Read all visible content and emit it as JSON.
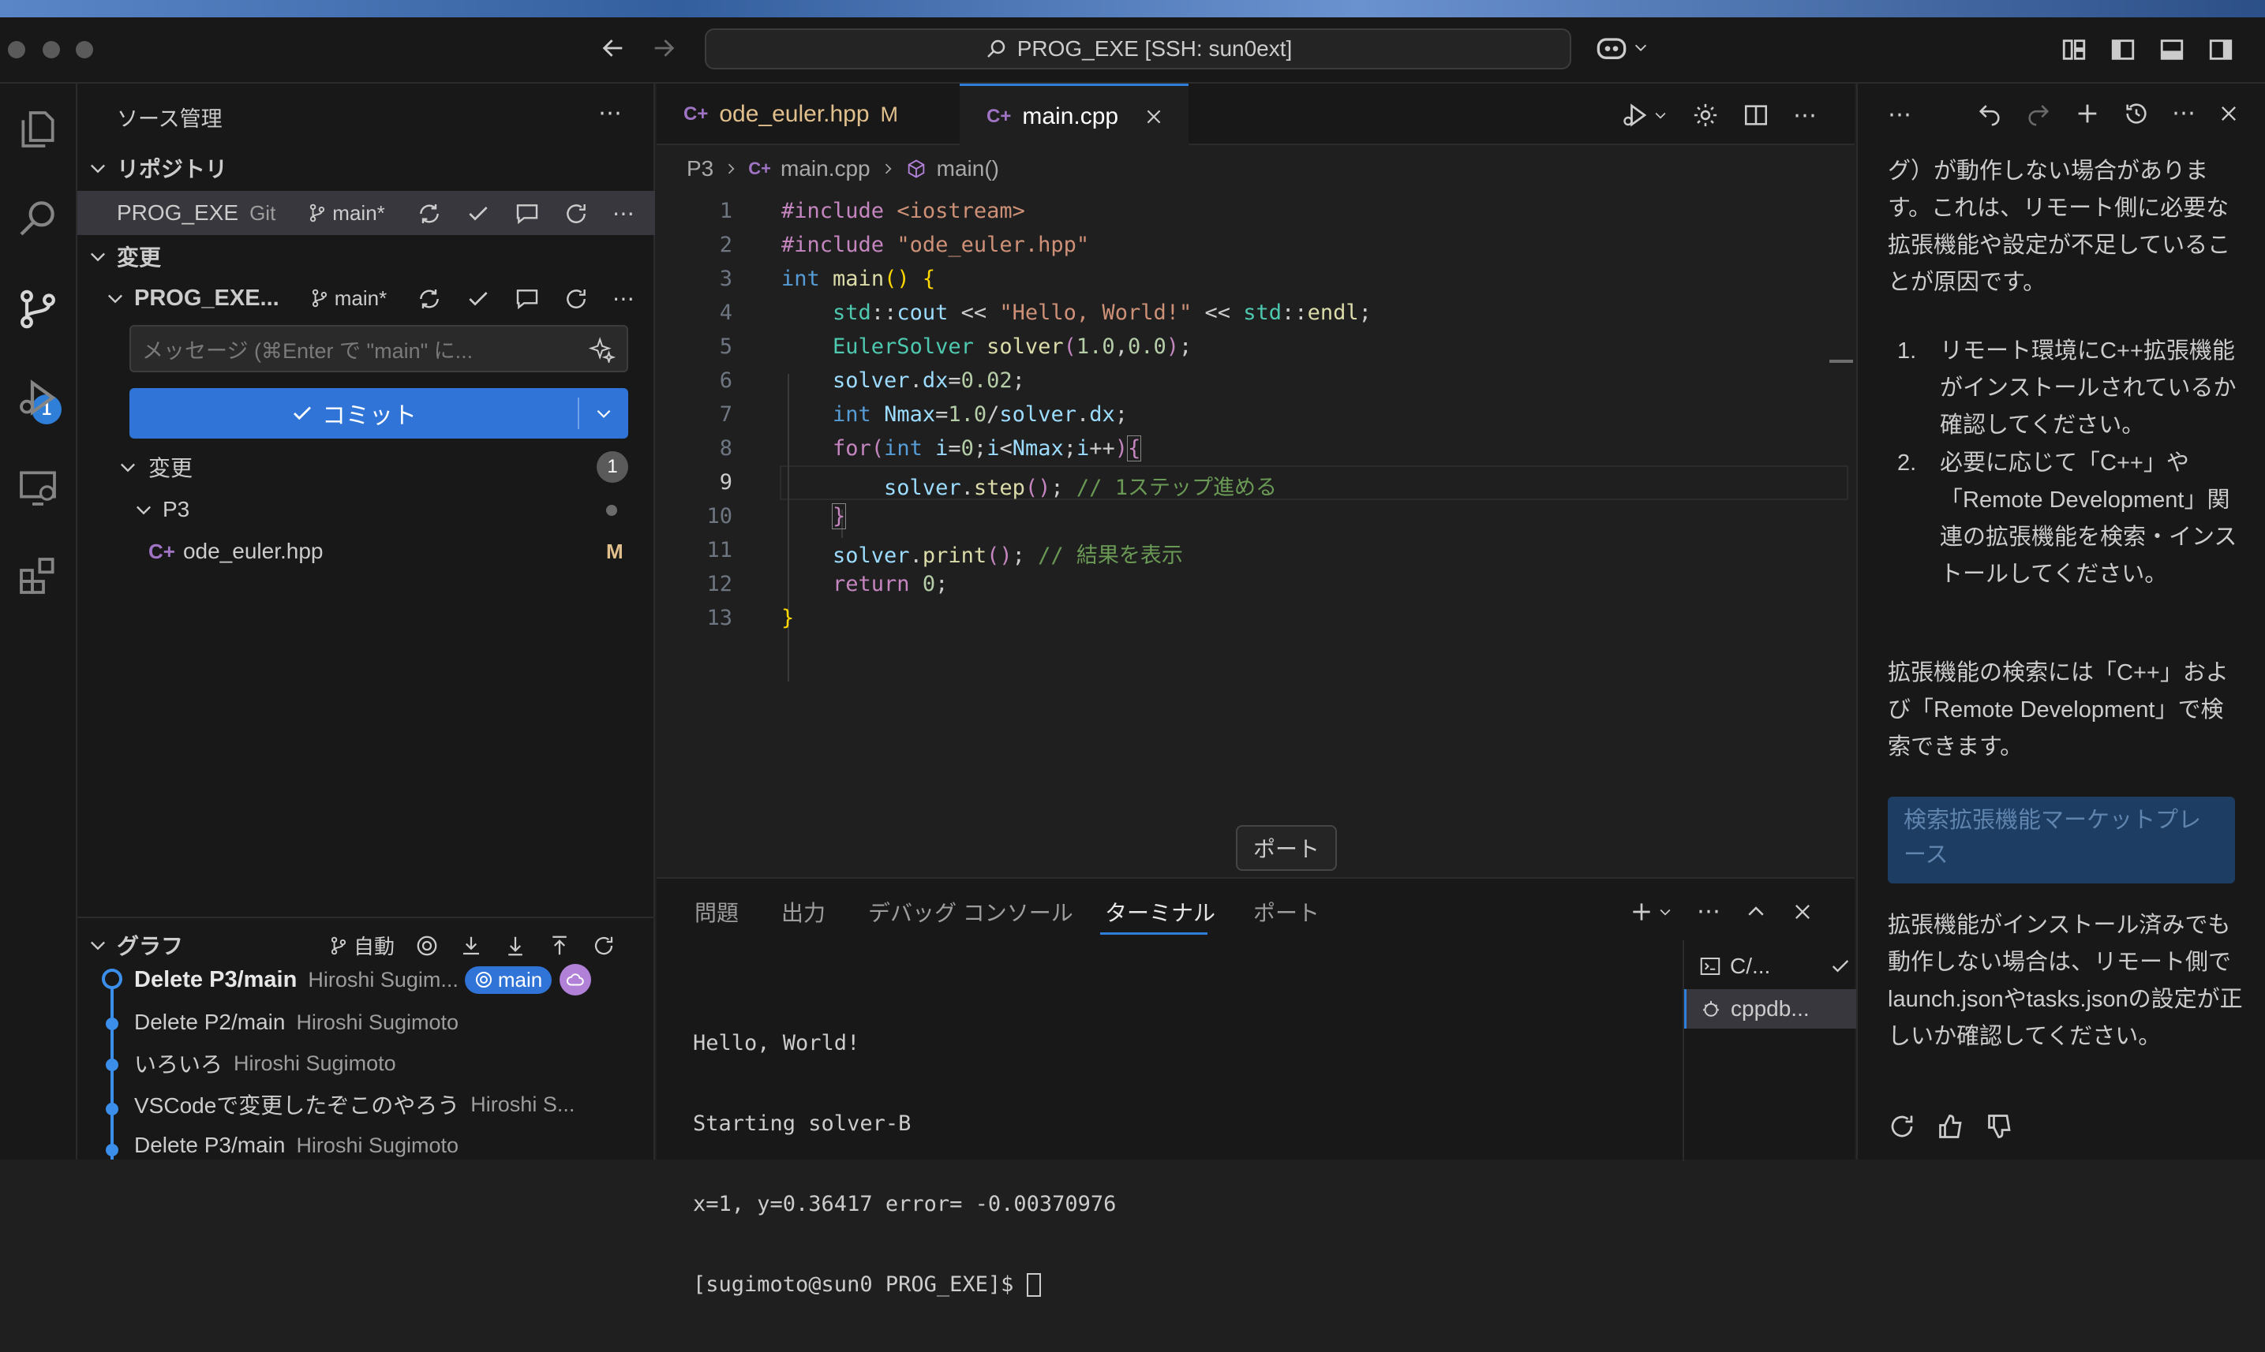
{
  "window": {
    "command_center": "PROG_EXE [SSH: sun0ext]"
  },
  "activity": {
    "scm_badge": "1"
  },
  "sidebar": {
    "title": "ソース管理",
    "repos_header": "リポジトリ",
    "repo_name": "PROG_EXE",
    "repo_type": "Git",
    "branch": "main*",
    "changes_header": "変更",
    "repo_changes_name": "PROG_EXE...",
    "commit_placeholder": "メッセージ (⌘Enter で \"main\" に...",
    "commit_label": "コミット",
    "changes_group": "変更",
    "changes_count": "1",
    "folder": "P3",
    "file_name": "ode_euler.hpp",
    "file_status": "M",
    "graph_header": "グラフ",
    "graph_auto": "自動",
    "graph": [
      {
        "msg": "Delete P3/main",
        "author": "Hiroshi Sugim...",
        "ref": "main"
      },
      {
        "msg": "Delete P2/main",
        "author": "Hiroshi Sugimoto"
      },
      {
        "msg": "いろいろ",
        "author": "Hiroshi Sugimoto"
      },
      {
        "msg": "VSCodeで変更したぞこのやろう",
        "author": "Hiroshi S..."
      },
      {
        "msg": "Delete P3/main",
        "author": "Hiroshi Sugimoto"
      }
    ]
  },
  "editor": {
    "tabs": [
      {
        "label": "ode_euler.hpp",
        "status": "M"
      },
      {
        "label": "main.cpp"
      }
    ],
    "breadcrumb": [
      "P3",
      "main.cpp",
      "main()"
    ],
    "line_numbers": [
      "1",
      "2",
      "3",
      "4",
      "5",
      "6",
      "7",
      "8",
      "9",
      "10",
      "11",
      "12",
      "13"
    ]
  },
  "panel": {
    "tabs": [
      "問題",
      "出力",
      "デバッグ コンソール",
      "ターミナル",
      "ポート"
    ],
    "terminal": [
      "Hello, World!",
      "Starting solver-B",
      "x=1, y=0.36417 error= -0.00370976",
      "[sugimoto@sun0 PROG_EXE]$ "
    ],
    "terminals": [
      "C/...",
      "cppdb..."
    ],
    "tooltip": "ポート"
  },
  "chat": {
    "p1": "グ）が動作しない場合があります。これは、リモート側に必要な拡張機能や設定が不足していることが原因です。",
    "li1": "リモート環境にC++拡張機能がインストールされているか確認してください。",
    "li2": "必要に応じて「C++」や「Remote Development」関連の拡張機能を検索・インストールしてください。",
    "p2": "拡張機能の検索には「C++」および「Remote Development」で検索できます。",
    "button": "検索拡張機能マーケットプレース",
    "p3": "拡張機能がインストール済みでも動作しない場合は、リモート側でlaunch.jsonやtasks.jsonの設定が正しいか確認してください。"
  }
}
